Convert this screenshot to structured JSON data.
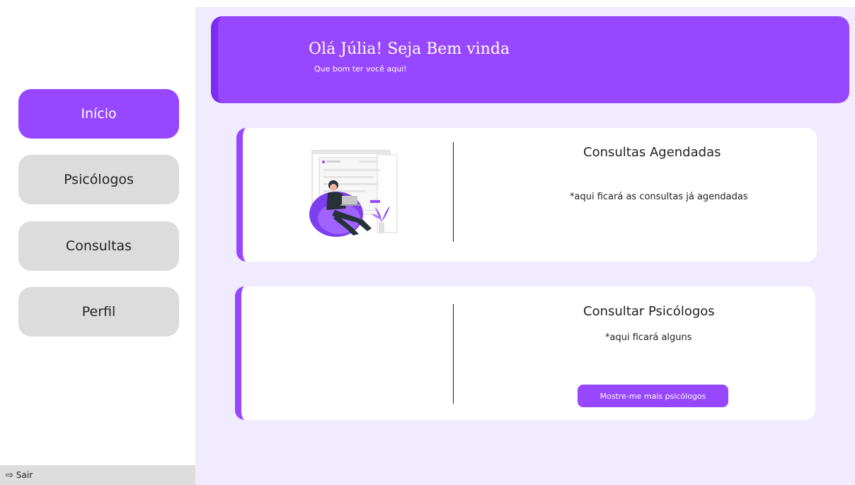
{
  "sidebar": {
    "items": [
      {
        "label": "Início",
        "active": true
      },
      {
        "label": "Psicólogos",
        "active": false
      },
      {
        "label": "Consultas",
        "active": false
      },
      {
        "label": "Perfil",
        "active": false
      }
    ],
    "logout_label": "Sair",
    "logout_icon": "logout-icon"
  },
  "header": {
    "greeting": "Olá Júlia! Seja Bem vinda",
    "subtitle": "Que bom ter você aqui!"
  },
  "cards": {
    "scheduled": {
      "title": "Consultas Agendadas",
      "text": "*aqui ficará as consultas já agendadas"
    },
    "psychologists": {
      "title": "Consultar Psicólogos",
      "text": "*aqui ficará alguns",
      "button_label": "Mostre-me mais psicólogos"
    }
  },
  "colors": {
    "accent": "#9747ff",
    "accent_dark": "#7d2df0",
    "background": "#f0ebff",
    "nav_inactive": "#dcdcdc"
  }
}
